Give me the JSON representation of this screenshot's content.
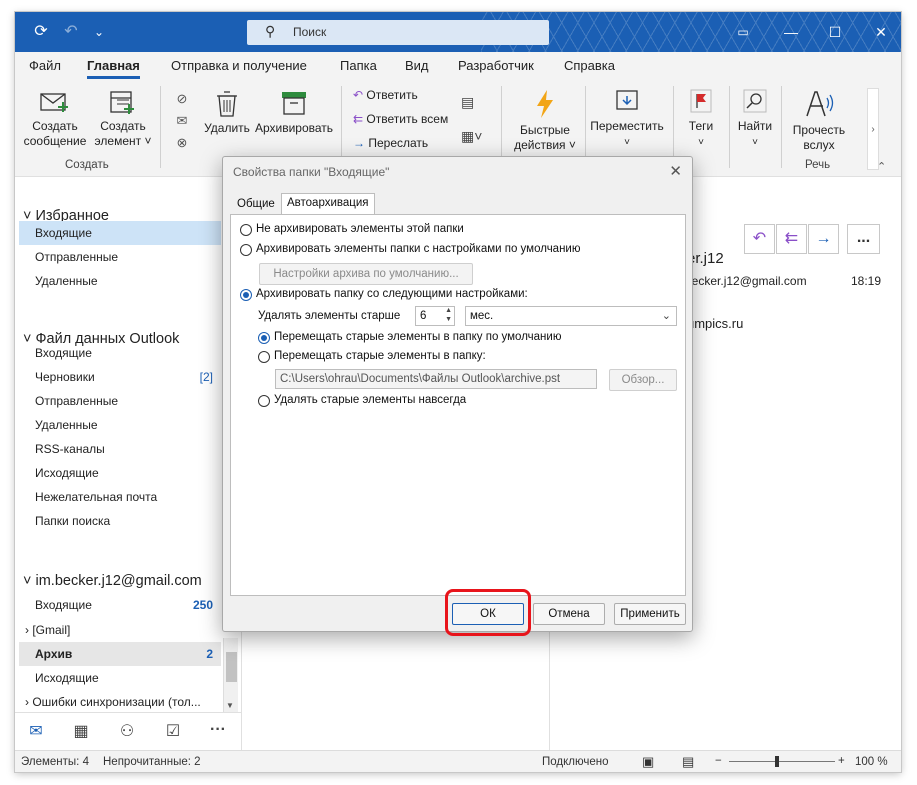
{
  "titlebar": {
    "search_placeholder": "Поиск"
  },
  "tabs": [
    "Файл",
    "Главная",
    "Отправка и получение",
    "Папка",
    "Вид",
    "Разработчик",
    "Справка"
  ],
  "ribbon": {
    "new_message": [
      "Создать",
      "сообщение"
    ],
    "new_item": [
      "Создать",
      "элемент ˅"
    ],
    "group_create": "Создать",
    "delete": "Удалить",
    "archive": "Архивировать",
    "reply": "Ответить",
    "reply_all": "Ответить всем",
    "forward": "Переслать",
    "quick_steps": [
      "Быстрые",
      "действия ˅"
    ],
    "move": "Переместить",
    "tags": "Теги",
    "find": "Найти",
    "read_aloud": [
      "Прочесть",
      "вслух"
    ],
    "group_speech": "Речь"
  },
  "nav": {
    "favorites": "Избранное",
    "fav_items": [
      "Входящие",
      "Отправленные",
      "Удаленные"
    ],
    "datafile": "Файл данных Outlook",
    "datafile_items": [
      {
        "label": "Входящие",
        "count": ""
      },
      {
        "label": "Черновики",
        "count": "[2]"
      },
      {
        "label": "Отправленные",
        "count": ""
      },
      {
        "label": "Удаленные",
        "count": ""
      },
      {
        "label": "RSS-каналы",
        "count": ""
      },
      {
        "label": "Исходящие",
        "count": ""
      },
      {
        "label": "Нежелательная почта",
        "count": ""
      },
      {
        "label": "Папки поиска",
        "count": ""
      }
    ],
    "account": "im.becker.j12@gmail.com",
    "account_items": [
      {
        "label": "Входящие",
        "count": "250"
      },
      {
        "label": "[Gmail]",
        "count": ""
      },
      {
        "label": "Архив",
        "count": "2"
      },
      {
        "label": "Исходящие",
        "count": ""
      },
      {
        "label": "Ошибки синхронизации (тол...",
        "count": ""
      }
    ]
  },
  "reading": {
    "sender_partial": "er.j12",
    "email_partial": "becker.j12@gmail.com",
    "time": "18:19",
    "domain_partial": "umpics.ru",
    "more": "..."
  },
  "status": {
    "items": "Элементы: 4",
    "unread": "Непрочитанные: 2",
    "connected": "Подключено",
    "zoom": "100 %"
  },
  "dialog": {
    "title": "Свойства папки \"Входящие\"",
    "tab_general": "Общие",
    "tab_autoarchive": "Автоархивация",
    "opt_no_archive": "Не архивировать элементы этой папки",
    "opt_default": "Архивировать элементы папки с настройками по умолчанию",
    "btn_default_settings": "Настройки архива по умолчанию...",
    "opt_custom": "Архивировать папку со следующими настройками:",
    "older_than_label": "Удалять элементы старше",
    "older_than_value": "6",
    "period_value": "мес.",
    "opt_move_default": "Перемещать старые элементы в папку по умолчанию",
    "opt_move_to": "Перемещать старые элементы в папку:",
    "path": "C:\\Users\\ohrau\\Documents\\Файлы Outlook\\archive.pst",
    "btn_browse": "Обзор...",
    "opt_delete": "Удалять старые элементы навсегда",
    "btn_ok": "ОК",
    "btn_cancel": "Отмена",
    "btn_apply": "Применить"
  }
}
